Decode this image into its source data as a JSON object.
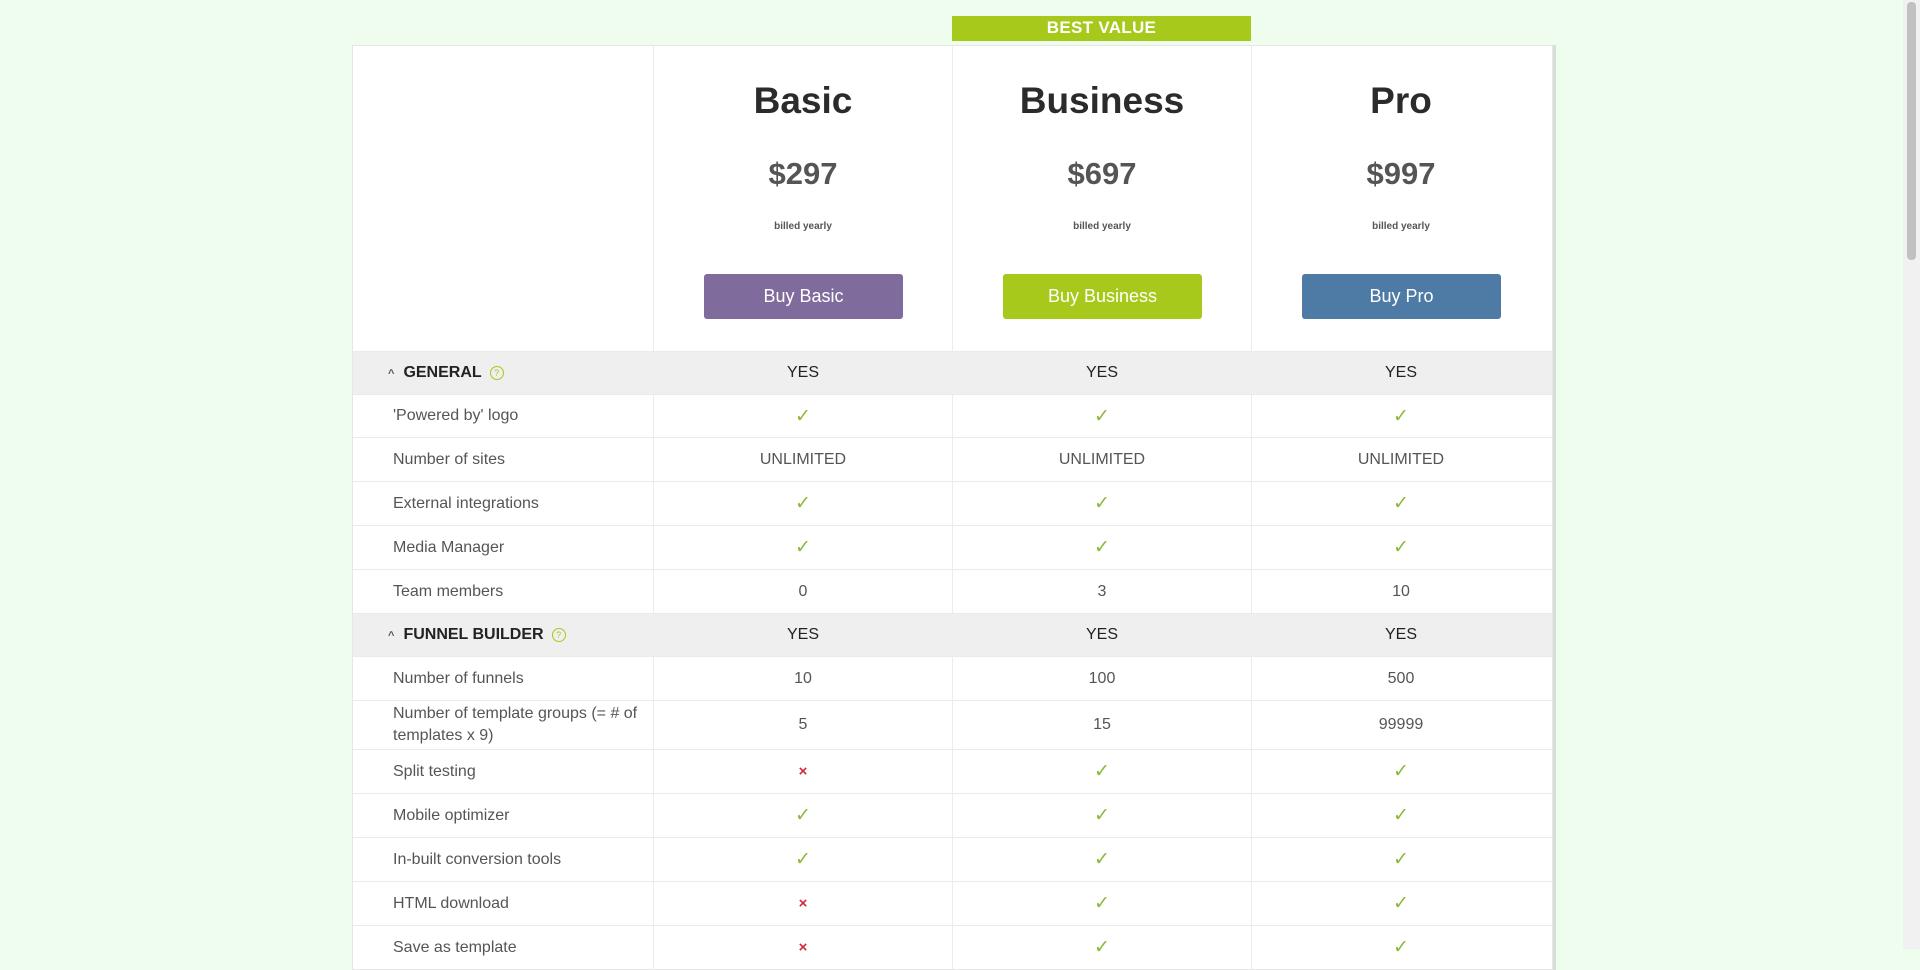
{
  "ribbon": "BEST VALUE",
  "plans": [
    {
      "name": "Basic",
      "price": "$297",
      "billing": "billed yearly",
      "button": "Buy Basic",
      "color": "#7f6c9c"
    },
    {
      "name": "Business",
      "price": "$697",
      "billing": "billed yearly",
      "button": "Buy Business",
      "color": "#a7c91b"
    },
    {
      "name": "Pro",
      "price": "$997",
      "billing": "billed yearly",
      "button": "Buy Pro",
      "color": "#4d7ba6"
    }
  ],
  "rows": [
    {
      "type": "section",
      "label": "GENERAL",
      "values": [
        "YES",
        "YES",
        "YES"
      ]
    },
    {
      "type": "feature",
      "label": "'Powered by' logo",
      "values": [
        "check",
        "check",
        "check"
      ]
    },
    {
      "type": "feature",
      "label": "Number of sites",
      "values": [
        "UNLIMITED",
        "UNLIMITED",
        "UNLIMITED"
      ]
    },
    {
      "type": "feature",
      "label": "External integrations",
      "values": [
        "check",
        "check",
        "check"
      ]
    },
    {
      "type": "feature",
      "label": "Media Manager",
      "values": [
        "check",
        "check",
        "check"
      ]
    },
    {
      "type": "feature",
      "label": "Team members",
      "values": [
        "0",
        "3",
        "10"
      ]
    },
    {
      "type": "section",
      "label": "FUNNEL BUILDER",
      "values": [
        "YES",
        "YES",
        "YES"
      ]
    },
    {
      "type": "feature",
      "label": "Number of funnels",
      "values": [
        "10",
        "100",
        "500"
      ]
    },
    {
      "type": "feature",
      "label": "Number of template groups (= # of templates x 9)",
      "values": [
        "5",
        "15",
        "99999"
      ]
    },
    {
      "type": "feature",
      "label": "Split testing",
      "values": [
        "cross",
        "check",
        "check"
      ]
    },
    {
      "type": "feature",
      "label": "Mobile optimizer",
      "values": [
        "check",
        "check",
        "check"
      ]
    },
    {
      "type": "feature",
      "label": "In-built conversion tools",
      "values": [
        "check",
        "check",
        "check"
      ]
    },
    {
      "type": "feature",
      "label": "HTML download",
      "values": [
        "cross",
        "check",
        "check"
      ]
    },
    {
      "type": "feature",
      "label": "Save as template",
      "values": [
        "cross",
        "check",
        "check"
      ]
    }
  ],
  "icons": {
    "check": "checkmark-icon",
    "cross": "cross-icon",
    "help": "help-circle-icon",
    "chevron": "chevron-up-icon"
  }
}
